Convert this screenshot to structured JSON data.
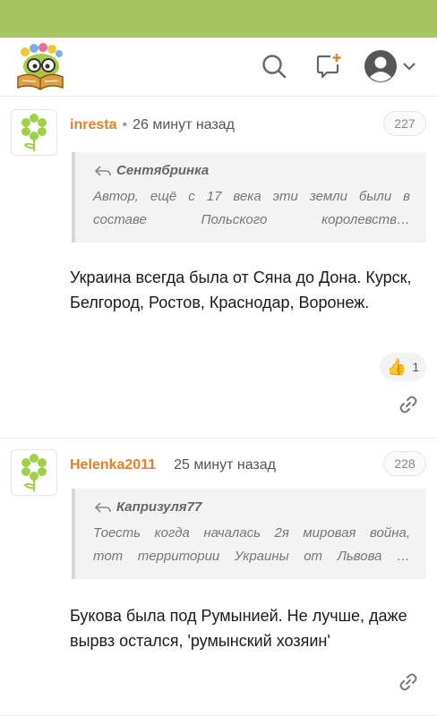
{
  "colors": {
    "topbar": "#a6c45f",
    "author": "#e0822a",
    "avatar_leaf": "#9fd04a"
  },
  "header": {
    "logo_icon": "owl-reading-book-icon",
    "search_icon": "search-icon",
    "new_comment_icon": "new-comment-icon",
    "account_icon": "user-avatar-icon",
    "dropdown_icon": "chevron-down-icon"
  },
  "comments": [
    {
      "author": "inresta",
      "time": "26 минут назад",
      "number": "227",
      "quote_author": "Сентябринка",
      "quote_line1": "Автор, ещё с 17 века эти земли были в",
      "quote_line2": "составе Польского королевств…",
      "text": "Украина всегда была от Сяна до Дона. Курск, Белгород, Ростов, Краснодар, Воронеж.",
      "likes": "1"
    },
    {
      "author": "Helenka2011",
      "time": "25 минут назад",
      "number": "228",
      "quote_author": "Капризуля77",
      "quote_line1": "Тоесть когда началась 2я мировая война,",
      "quote_line2": "тот территории Украины от Львова …",
      "text": "Букова была под Румынией. Не лучше, даже вырвз остался, 'румынский хозяин'"
    }
  ]
}
